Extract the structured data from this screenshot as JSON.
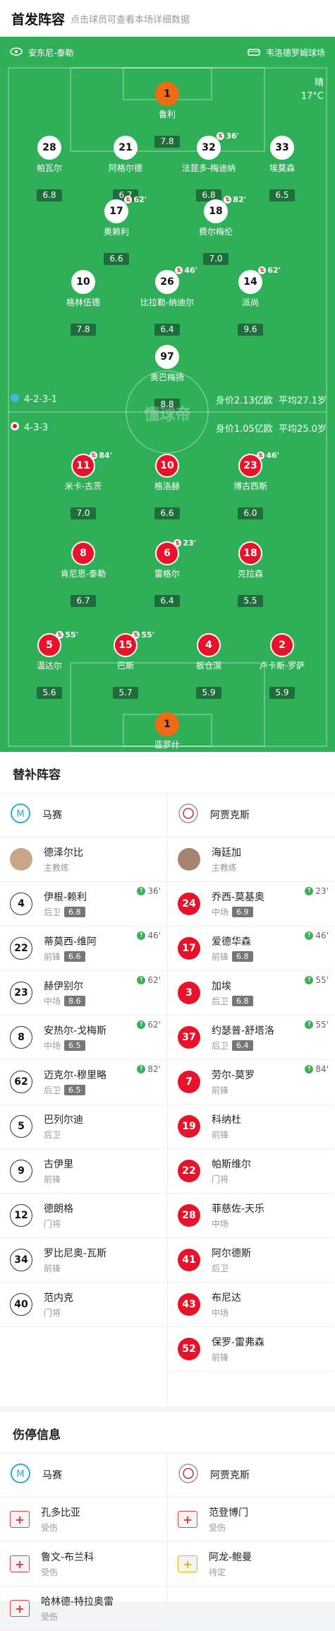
{
  "header": {
    "title": "首发阵容",
    "subtitle": "点击球员可查看本场详细数据"
  },
  "teams": {
    "home": "安东尼-泰勒",
    "away": "韦洛德罗姆球场"
  },
  "weather": {
    "cond": "晴",
    "temp": "17°C"
  },
  "top_formation": {
    "formation": "4-2-3-1",
    "value": "身价2.13亿欧",
    "age": "平均27.1岁"
  },
  "bottom_formation": {
    "formation": "4-3-3",
    "value": "身价1.05亿欧",
    "age": "平均25.0岁"
  },
  "pitch_logo": "懂球帝",
  "top_players": [
    {
      "num": "1",
      "name": "鲁利",
      "rating": "7.8",
      "style": "o"
    },
    {
      "num": "28",
      "name": "帕瓦尔",
      "rating": "6.8",
      "style": "w"
    },
    {
      "num": "21",
      "name": "阿格尔德",
      "rating": "6.7",
      "style": "w"
    },
    {
      "num": "32",
      "name": "法昆多-梅迪纳",
      "rating": "6.8",
      "style": "w",
      "sub": "36'"
    },
    {
      "num": "33",
      "name": "埃莫森",
      "rating": "6.5",
      "style": "w"
    },
    {
      "num": "17",
      "name": "奥赖利",
      "rating": "6.6",
      "style": "w",
      "sub": "62'"
    },
    {
      "num": "18",
      "name": "费尔梅伦",
      "rating": "7.0",
      "style": "w",
      "sub": "82'"
    },
    {
      "num": "10",
      "name": "格林伍德",
      "rating": "7.8",
      "style": "w"
    },
    {
      "num": "26",
      "name": "比拉勒-纳迪尔",
      "rating": "6.4",
      "style": "w",
      "sub": "46'"
    },
    {
      "num": "14",
      "name": "派尚",
      "rating": "9.6",
      "style": "w",
      "sub": "62'"
    },
    {
      "num": "97",
      "name": "奥巴梅扬",
      "rating": "8.8",
      "style": "w"
    }
  ],
  "bottom_players": [
    {
      "num": "11",
      "name": "米卡-古茨",
      "rating": "7.0",
      "style": "r",
      "sub": "84'"
    },
    {
      "num": "10",
      "name": "格洛赫",
      "rating": "6.6",
      "style": "r"
    },
    {
      "num": "23",
      "name": "博古西斯",
      "rating": "6.0",
      "style": "r",
      "sub": "46'"
    },
    {
      "num": "8",
      "name": "肯尼思-泰勒",
      "rating": "6.7",
      "style": "r"
    },
    {
      "num": "6",
      "name": "雷格尔",
      "rating": "6.4",
      "style": "r",
      "sub": "23'"
    },
    {
      "num": "18",
      "name": "克拉森",
      "rating": "5.5",
      "style": "r"
    },
    {
      "num": "5",
      "name": "温达尔",
      "rating": "5.6",
      "style": "r",
      "sub": "55'"
    },
    {
      "num": "15",
      "name": "巴斯",
      "rating": "5.7",
      "style": "r",
      "sub": "55'"
    },
    {
      "num": "4",
      "name": "板仓滉",
      "rating": "5.9",
      "style": "r"
    },
    {
      "num": "2",
      "name": "卢卡斯-罗萨",
      "rating": "5.9",
      "style": "r"
    },
    {
      "num": "1",
      "name": "亚罗什",
      "rating": "4.8",
      "style": "o"
    }
  ],
  "subs": {
    "title": "替补阵容",
    "home_team": "马赛",
    "away_team": "阿贾克斯",
    "home_coach": {
      "name": "德泽尔比",
      "role": "主教练"
    },
    "away_coach": {
      "name": "海廷加",
      "role": "主教练"
    },
    "home": [
      {
        "num": "4",
        "name": "伊根-赖利",
        "pos": "后卫",
        "score": "6.8",
        "min": "36'"
      },
      {
        "num": "22",
        "name": "蒂莫西-维阿",
        "pos": "前锋",
        "score": "6.6",
        "min": "46'"
      },
      {
        "num": "23",
        "name": "赫伊别尔",
        "pos": "中场",
        "score": "8.6",
        "min": "62'"
      },
      {
        "num": "8",
        "name": "安热尔-戈梅斯",
        "pos": "中场",
        "score": "6.5",
        "min": "62'"
      },
      {
        "num": "62",
        "name": "迈克尔-穆里略",
        "pos": "后卫",
        "score": "6.5",
        "min": "82'"
      },
      {
        "num": "5",
        "name": "巴列尔迪",
        "pos": "后卫",
        "score": "",
        "min": ""
      },
      {
        "num": "9",
        "name": "古伊里",
        "pos": "前锋",
        "score": "",
        "min": ""
      },
      {
        "num": "12",
        "name": "德朗格",
        "pos": "门将",
        "score": "",
        "min": ""
      },
      {
        "num": "34",
        "name": "罗比尼奥-瓦斯",
        "pos": "前锋",
        "score": "",
        "min": ""
      },
      {
        "num": "40",
        "name": "范内克",
        "pos": "门将",
        "score": "",
        "min": ""
      }
    ],
    "away": [
      {
        "num": "24",
        "name": "乔西-莫基奥",
        "pos": "中场",
        "score": "6.9",
        "min": "23'"
      },
      {
        "num": "17",
        "name": "爱德华森",
        "pos": "前锋",
        "score": "6.8",
        "min": "46'"
      },
      {
        "num": "3",
        "name": "加埃",
        "pos": "后卫",
        "score": "6.8",
        "min": "55'"
      },
      {
        "num": "37",
        "name": "约瑟普-舒塔洛",
        "pos": "后卫",
        "score": "6.4",
        "min": "55'"
      },
      {
        "num": "7",
        "name": "劳尔-莫罗",
        "pos": "前锋",
        "score": "",
        "min": "84'"
      },
      {
        "num": "19",
        "name": "科纳杜",
        "pos": "前锋",
        "score": "",
        "min": ""
      },
      {
        "num": "22",
        "name": "帕斯维尔",
        "pos": "门将",
        "score": "",
        "min": ""
      },
      {
        "num": "28",
        "name": "菲慈佐-天乐",
        "pos": "中场",
        "score": "",
        "min": ""
      },
      {
        "num": "41",
        "name": "阿尔德斯",
        "pos": "后卫",
        "score": "",
        "min": ""
      },
      {
        "num": "43",
        "name": "布尼达",
        "pos": "中场",
        "score": "",
        "min": ""
      },
      {
        "num": "52",
        "name": "保罗-雷弗森",
        "pos": "前锋",
        "score": "",
        "min": ""
      }
    ]
  },
  "injuries": {
    "title": "伤停信息",
    "home_team": "马赛",
    "away_team": "阿贾克斯",
    "home": [
      {
        "name": "孔多比亚",
        "status": "受伤"
      },
      {
        "name": "鲁文-布兰科",
        "status": "受伤"
      },
      {
        "name": "哈林德-特拉奥雷",
        "status": "受伤"
      }
    ],
    "away": [
      {
        "name": "范登博门",
        "status": "受伤"
      },
      {
        "name": "阿龙-鲍曼",
        "status": "待定"
      }
    ]
  }
}
